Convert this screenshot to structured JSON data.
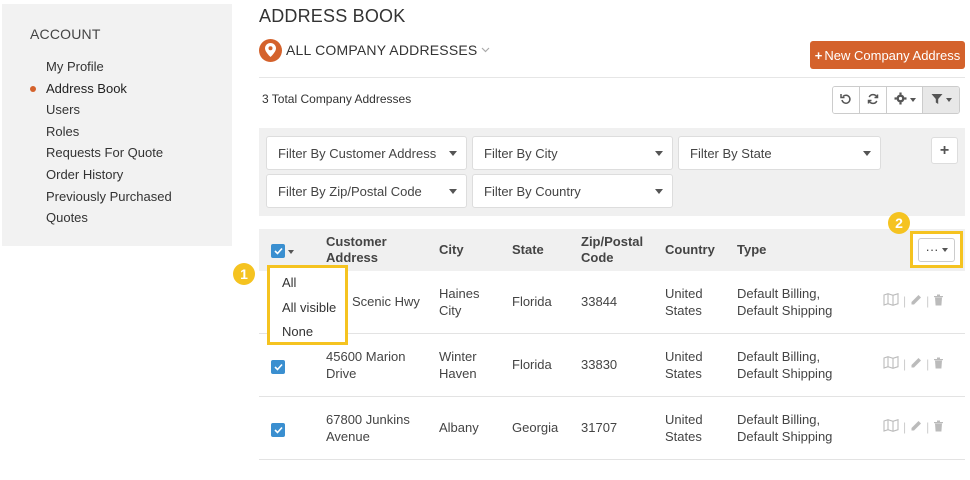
{
  "sidebar": {
    "title": "ACCOUNT",
    "items": [
      {
        "label": "My Profile"
      },
      {
        "label": "Address Book"
      },
      {
        "label": "Users"
      },
      {
        "label": "Roles"
      },
      {
        "label": "Requests For Quote"
      },
      {
        "label": "Order History"
      },
      {
        "label": "Previously Purchased"
      },
      {
        "label": "Quotes"
      }
    ],
    "active_item": "Address Book"
  },
  "header": {
    "title": "ADDRESS BOOK",
    "location_selector": "ALL COMPANY ADDRESSES",
    "new_button": "New Company Address",
    "new_button_prefix": "+"
  },
  "toolbar": {
    "total_text": "3 Total Company Addresses",
    "buttons": [
      "undo-icon",
      "refresh-icon",
      "gear-icon",
      "filter-icon"
    ]
  },
  "filters": [
    {
      "label": "Filter By Customer Address"
    },
    {
      "label": "Filter By City"
    },
    {
      "label": "Filter By State"
    },
    {
      "label": "Filter By Zip/Postal Code"
    },
    {
      "label": "Filter By Country"
    }
  ],
  "filter_add": "+",
  "table": {
    "columns": {
      "address_l1": "Customer",
      "address_l2": "Address",
      "city": "City",
      "state": "State",
      "zip_l1": "Zip/Postal",
      "zip_l2": "Code",
      "country": "Country",
      "type": "Type"
    },
    "rows": [
      {
        "address_l1": "Scenic Hwy",
        "address_l2": "",
        "city_l1": "Haines",
        "city_l2": "City",
        "state": "Florida",
        "zip": "33844",
        "country_l1": "United",
        "country_l2": "States",
        "type_l1": "Default Billing,",
        "type_l2": "Default Shipping"
      },
      {
        "address_l1": "45600 Marion",
        "address_l2": "Drive",
        "city_l1": "Winter",
        "city_l2": "Haven",
        "state": "Florida",
        "zip": "33830",
        "country_l1": "United",
        "country_l2": "States",
        "type_l1": "Default Billing,",
        "type_l2": "Default Shipping"
      },
      {
        "address_l1": "67800 Junkins",
        "address_l2": "Avenue",
        "city_l1": "Albany",
        "city_l2": "",
        "state": "Georgia",
        "zip": "31707",
        "country_l1": "United",
        "country_l2": "States",
        "type_l1": "Default Billing,",
        "type_l2": "Default Shipping"
      }
    ],
    "more_button": "···"
  },
  "select_menu": {
    "items": [
      "All",
      "All visible",
      "None"
    ]
  },
  "callouts": {
    "one": "1",
    "two": "2"
  },
  "colors": {
    "accent": "#d4622c",
    "checkbox": "#3a8fd0",
    "highlight": "#f5c320"
  }
}
